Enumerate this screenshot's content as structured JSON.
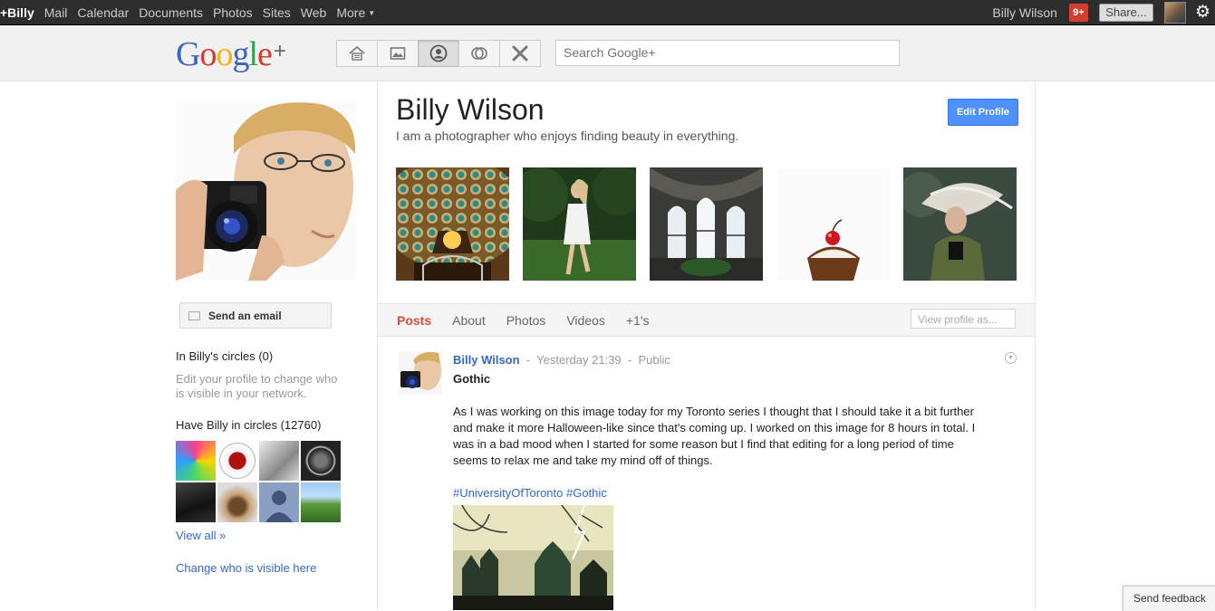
{
  "topbar": {
    "nav": [
      "+Billy",
      "Mail",
      "Calendar",
      "Documents",
      "Photos",
      "Sites",
      "Web",
      "More"
    ],
    "username": "Billy Wilson",
    "notification_count": "9+",
    "share_label": "Share...",
    "colors": {
      "bar": "#2d2d2d",
      "notification": "#d23f30"
    }
  },
  "header": {
    "logo": {
      "letters": [
        "G",
        "o",
        "o",
        "g",
        "l",
        "e"
      ],
      "plus": "+"
    },
    "nav_icons": [
      "home-icon",
      "photos-icon",
      "profile-icon",
      "circles-icon",
      "games-icon"
    ],
    "search_placeholder": "Search Google+"
  },
  "sidebar": {
    "send_email": "Send an email",
    "in_circles": "In Billy's circles (0)",
    "edit_hint": "Edit your profile to change who is visible in your network.",
    "have_in_circles": "Have Billy in circles (12760)",
    "view_all": "View all »",
    "change_visible": "Change who is visible here"
  },
  "profile": {
    "name": "Billy Wilson",
    "tagline": "I am a photographer who enjoys finding beauty in everything.",
    "edit_button": "Edit Profile",
    "accent": "#4d90fe"
  },
  "tabs": {
    "items": [
      "Posts",
      "About",
      "Photos",
      "Videos",
      "+1's"
    ],
    "active": "Posts",
    "view_as_placeholder": "View profile as..."
  },
  "post": {
    "author": "Billy Wilson",
    "sep": "-",
    "time": "Yesterday 21:39",
    "visibility": "Public",
    "title": "Gothic",
    "body": "As I was working on this image today for my Toronto series I thought that I should take it a bit further and make it more Halloween-like since that's coming up. I worked on this image for 8 hours in total. I was in a bad mood when I started for some reason but I find that editing for a long period of time seems to relax me and take my mind off of things.",
    "tags": "#UniversityOfToronto #Gothic"
  },
  "feedback": "Send feedback"
}
